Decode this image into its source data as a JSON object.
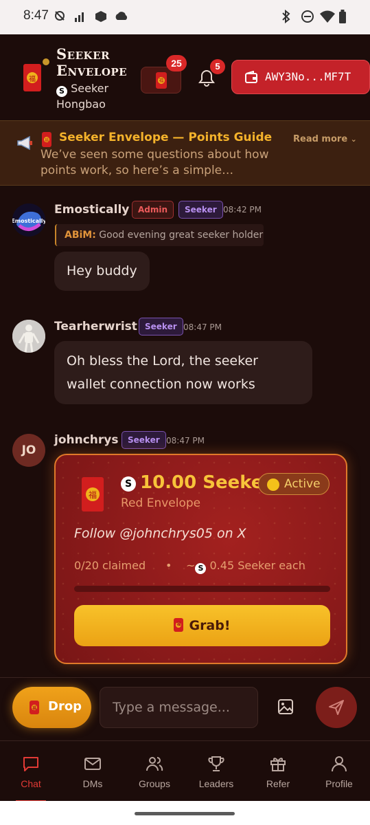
{
  "status_bar": {
    "time": "8:47"
  },
  "header": {
    "brand_title_line1": "Seeker",
    "brand_title_line2": "Envelope",
    "brand_sub": "Seeker Hongbao",
    "envelope_count": "25",
    "notification_count": "5",
    "wallet_address": "AWY3No...MF7T"
  },
  "announcement": {
    "title": "Seeker Envelope — Points Guide",
    "text": "We’ve seen some questions about how points work, so here’s a simple…",
    "read_more": "Read more"
  },
  "messages": [
    {
      "user": "Emostically",
      "avatar_label": "Emostically",
      "tags": [
        "Admin",
        "Seeker"
      ],
      "time": "08:42 PM",
      "reply_to_user": "ABiM:",
      "reply_to_text": "Good evening great seeker holder",
      "text": "Hey buddy"
    },
    {
      "user": "Tearherwrist",
      "tags": [
        "Seeker"
      ],
      "time": "08:47 PM",
      "text_line1": "Oh bless the Lord, the seeker",
      "text_line2": "wallet connection now works"
    },
    {
      "user": "johnchrys",
      "avatar_initials": "JO",
      "tags": [
        "Seeker"
      ],
      "time": "08:47 PM"
    }
  ],
  "red_envelope": {
    "amount": "10.00 Seeker",
    "label": "Red Envelope",
    "status": "Active",
    "task": "Follow @johnchrys05 on X",
    "claimed": "0/20 claimed",
    "separator": "•",
    "each_prefix": "~",
    "each": "0.45 Seeker each",
    "progress_fraction": 0,
    "grab_label": "Grab!"
  },
  "input_bar": {
    "drop_label": "Drop",
    "message_placeholder": "Type a message..."
  },
  "nav": {
    "items": [
      {
        "label": "Chat",
        "icon": "chat-icon",
        "active": true
      },
      {
        "label": "DMs",
        "icon": "mail-icon"
      },
      {
        "label": "Groups",
        "icon": "groups-icon"
      },
      {
        "label": "Leaders",
        "icon": "trophy-icon"
      },
      {
        "label": "Refer",
        "icon": "gift-icon"
      },
      {
        "label": "Profile",
        "icon": "profile-icon"
      }
    ]
  },
  "colors": {
    "background": "#1c0c0a",
    "accent_red": "#c42229",
    "accent_gold": "#f4b22b",
    "seeker_tag": "#b890f0",
    "admin_tag": "#ec5b5b"
  }
}
